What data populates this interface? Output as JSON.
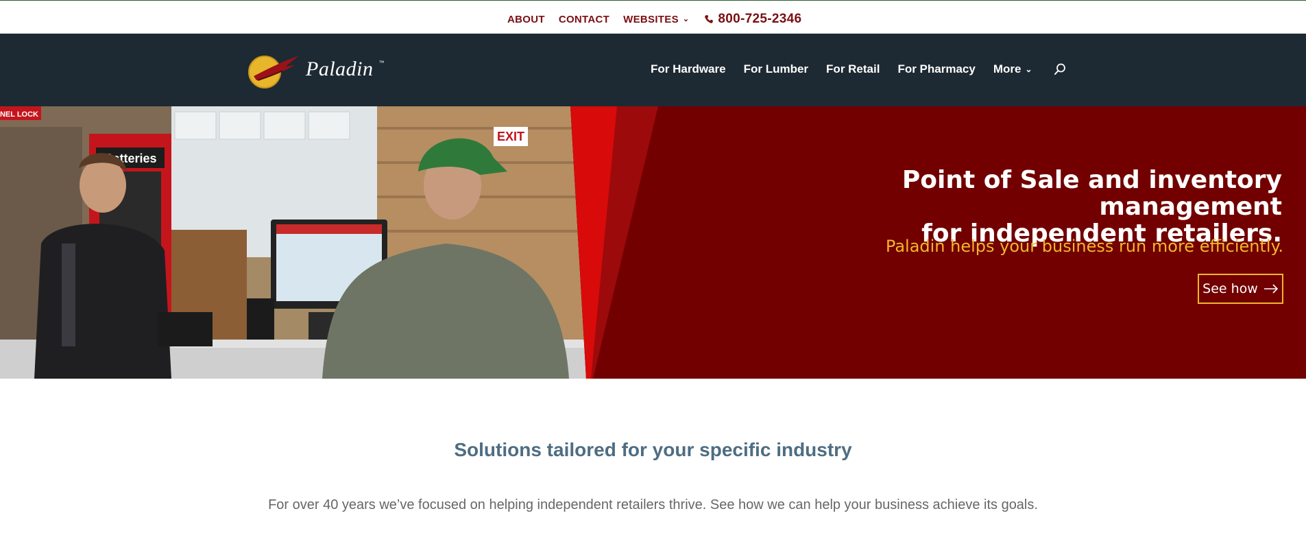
{
  "topnav": {
    "about": "ABOUT",
    "contact": "CONTACT",
    "websites": "WEBSITES",
    "phone": "800-725-2346"
  },
  "brand": {
    "name": "Paladin",
    "tm": "™"
  },
  "mainnav": {
    "items": [
      "For Hardware",
      "For Lumber",
      "For Retail",
      "For Pharmacy"
    ],
    "more": "More"
  },
  "hero": {
    "headline_line1": "Point of Sale and inventory management",
    "headline_line2": "for independent retailers.",
    "subline": "Paladin helps your business run more efficiently.",
    "cta": "See how",
    "photo_text": {
      "batteries": "Batteries",
      "exit": "EXIT",
      "lock": "NEL LOCK"
    }
  },
  "section": {
    "title": "Solutions tailored for your specific industry",
    "body": "For over 40 years we’ve focused on helping independent retailers thrive. See how we can help your business achieve its goals."
  },
  "colors": {
    "accent_red": "#7a0f12",
    "nav_bg": "#1e2a33",
    "hero_red": "#720000",
    "gold": "#f3b62b",
    "title_blue": "#4e6d82"
  }
}
